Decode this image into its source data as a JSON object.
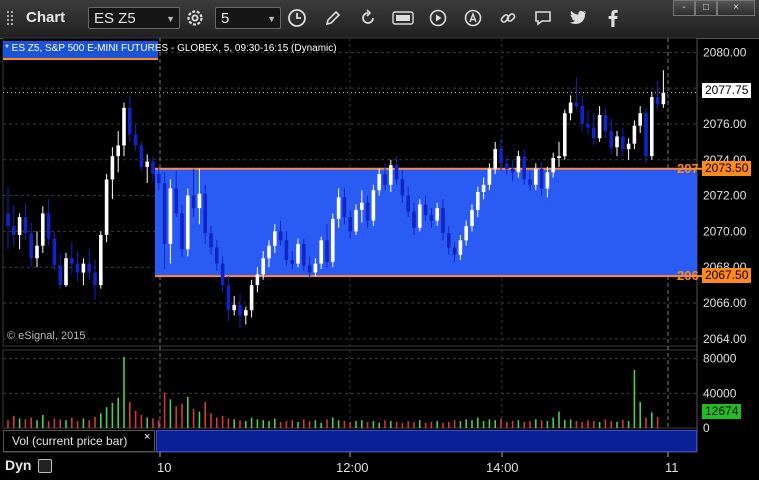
{
  "window": {
    "title": "Chart",
    "symbol": "ES Z5",
    "interval": "5",
    "controls": {
      "minimize": "-",
      "maximize": "□",
      "close": "×"
    }
  },
  "toolbar": {
    "icons": [
      "settings-gear-icon",
      "clock-icon",
      "pencil-draw-icon",
      "refresh-icon",
      "get-quote-icon",
      "play-icon",
      "alert-icon",
      "link-icon",
      "chat-icon",
      "twitter-icon",
      "facebook-icon"
    ]
  },
  "chart": {
    "legend": "* ES Z5, S&P 500 E-MINI FUTURES - GLOBEX, 5, 09:30-16:15 (Dynamic)",
    "copyright": "© eSignal, 2015",
    "last_price": "2077.75",
    "upper_level": {
      "label": "2073.50",
      "cut_label": "207"
    },
    "lower_level": {
      "label": "2067.50",
      "cut_label": "206"
    },
    "price_axis": [
      "2080.00",
      "2078.00",
      "2076.00",
      "2074.00",
      "2072.00",
      "2070.00",
      "2068.00",
      "2066.00",
      "2064.00"
    ],
    "volume_axis": [
      "80000",
      "40000",
      "0"
    ],
    "last_volume": "12674",
    "time_axis": [
      "10",
      "12:00",
      "14:00",
      "11"
    ],
    "volume_study_title": "Vol (current price bar)",
    "volume_study_close": "×",
    "dynamic_label": "Dyn"
  },
  "chart_data": {
    "type": "candlestick",
    "symbol": "ES Z5",
    "ylim": [
      2064,
      2081
    ],
    "volume_ylim": [
      0,
      90000
    ],
    "upper_level": 2073.5,
    "lower_level": 2067.5,
    "last_price": 2077.75,
    "last_volume": 12674,
    "candles": [
      [
        2071.0,
        2072.5,
        2069.0,
        2070.3
      ],
      [
        2070.3,
        2071.5,
        2069.2,
        2069.8
      ],
      [
        2069.8,
        2071.0,
        2069.0,
        2070.8
      ],
      [
        2070.8,
        2071.6,
        2069.5,
        2069.9
      ],
      [
        2069.9,
        2070.5,
        2068.0,
        2068.5
      ],
      [
        2068.5,
        2070.0,
        2068.0,
        2069.2
      ],
      [
        2069.2,
        2071.4,
        2068.8,
        2071.0
      ],
      [
        2071.0,
        2071.8,
        2069.2,
        2069.6
      ],
      [
        2069.6,
        2070.0,
        2067.8,
        2068.1
      ],
      [
        2068.1,
        2068.8,
        2066.8,
        2067.0
      ],
      [
        2067.0,
        2068.8,
        2066.9,
        2068.5
      ],
      [
        2068.5,
        2069.4,
        2067.6,
        2068.2
      ],
      [
        2068.2,
        2068.9,
        2067.2,
        2067.7
      ],
      [
        2067.7,
        2068.5,
        2067.0,
        2068.2
      ],
      [
        2068.2,
        2069.0,
        2067.3,
        2067.7
      ],
      [
        2067.7,
        2068.4,
        2066.2,
        2067.0
      ],
      [
        2067.0,
        2070.0,
        2066.8,
        2069.8
      ],
      [
        2069.8,
        2073.2,
        2069.4,
        2072.9
      ],
      [
        2072.9,
        2074.7,
        2071.8,
        2074.2
      ],
      [
        2074.2,
        2075.6,
        2073.3,
        2074.8
      ],
      [
        2074.8,
        2077.2,
        2074.2,
        2076.9
      ],
      [
        2076.9,
        2077.6,
        2075.0,
        2075.4
      ],
      [
        2075.4,
        2076.0,
        2074.5,
        2074.8
      ],
      [
        2074.8,
        2075.0,
        2073.4,
        2073.6
      ],
      [
        2073.6,
        2074.3,
        2072.7,
        2073.9
      ],
      [
        2073.9,
        2074.2,
        2072.8,
        2073.2
      ],
      [
        2073.2,
        2073.6,
        2072.3,
        2072.7
      ],
      [
        2072.7,
        2073.3,
        2067.9,
        2069.3
      ],
      [
        2069.3,
        2072.9,
        2068.2,
        2072.4
      ],
      [
        2072.4,
        2073.4,
        2070.8,
        2071.0
      ],
      [
        2071.0,
        2071.5,
        2068.6,
        2069.0
      ],
      [
        2069.0,
        2072.4,
        2068.6,
        2072.0
      ],
      [
        2072.0,
        2073.5,
        2070.8,
        2071.3
      ],
      [
        2071.3,
        2073.5,
        2070.4,
        2072.1
      ],
      [
        2072.1,
        2072.6,
        2069.3,
        2069.9
      ],
      [
        2069.9,
        2070.3,
        2068.7,
        2069.1
      ],
      [
        2069.1,
        2069.5,
        2067.8,
        2068.2
      ],
      [
        2068.2,
        2068.6,
        2066.6,
        2067.0
      ],
      [
        2067.0,
        2067.5,
        2065.0,
        2065.6
      ],
      [
        2065.6,
        2066.4,
        2065.3,
        2065.9
      ],
      [
        2065.9,
        2066.5,
        2064.6,
        2065.3
      ],
      [
        2065.3,
        2065.8,
        2064.8,
        2065.6
      ],
      [
        2065.6,
        2067.3,
        2065.2,
        2067.0
      ],
      [
        2067.0,
        2068.0,
        2066.6,
        2067.6
      ],
      [
        2067.6,
        2068.9,
        2067.3,
        2068.5
      ],
      [
        2068.5,
        2069.5,
        2068.0,
        2069.2
      ],
      [
        2069.2,
        2070.4,
        2068.8,
        2070.0
      ],
      [
        2070.0,
        2070.6,
        2069.2,
        2069.5
      ],
      [
        2069.5,
        2070.0,
        2068.1,
        2068.4
      ],
      [
        2068.4,
        2068.9,
        2067.9,
        2068.2
      ],
      [
        2068.2,
        2069.6,
        2068.0,
        2069.3
      ],
      [
        2069.3,
        2069.6,
        2067.8,
        2068.1
      ],
      [
        2068.1,
        2068.6,
        2067.4,
        2067.7
      ],
      [
        2067.7,
        2068.5,
        2067.5,
        2068.2
      ],
      [
        2068.2,
        2069.7,
        2067.9,
        2069.5
      ],
      [
        2069.5,
        2070.4,
        2068.0,
        2068.3
      ],
      [
        2068.3,
        2071.0,
        2068.0,
        2070.7
      ],
      [
        2070.7,
        2072.4,
        2070.2,
        2071.9
      ],
      [
        2071.9,
        2072.4,
        2070.4,
        2070.8
      ],
      [
        2070.8,
        2071.2,
        2069.6,
        2070.0
      ],
      [
        2070.0,
        2071.5,
        2069.8,
        2071.2
      ],
      [
        2071.2,
        2072.3,
        2070.5,
        2071.6
      ],
      [
        2071.6,
        2072.0,
        2070.2,
        2070.6
      ],
      [
        2070.6,
        2072.6,
        2070.3,
        2072.3
      ],
      [
        2072.3,
        2073.5,
        2072.0,
        2073.2
      ],
      [
        2073.2,
        2073.8,
        2072.3,
        2072.6
      ],
      [
        2072.6,
        2074.0,
        2072.2,
        2073.7
      ],
      [
        2073.7,
        2074.2,
        2072.6,
        2072.9
      ],
      [
        2072.9,
        2073.4,
        2071.6,
        2072.0
      ],
      [
        2072.0,
        2072.5,
        2070.8,
        2071.1
      ],
      [
        2071.1,
        2071.6,
        2069.8,
        2070.2
      ],
      [
        2070.2,
        2071.8,
        2070.0,
        2071.5
      ],
      [
        2071.5,
        2072.0,
        2070.6,
        2070.9
      ],
      [
        2070.9,
        2071.3,
        2070.2,
        2070.6
      ],
      [
        2070.6,
        2071.6,
        2070.3,
        2071.3
      ],
      [
        2071.3,
        2071.8,
        2069.5,
        2069.9
      ],
      [
        2069.9,
        2070.3,
        2068.7,
        2069.1
      ],
      [
        2069.1,
        2069.4,
        2068.3,
        2068.7
      ],
      [
        2068.7,
        2069.8,
        2068.4,
        2069.5
      ],
      [
        2069.5,
        2070.6,
        2069.2,
        2070.3
      ],
      [
        2070.3,
        2071.5,
        2070.0,
        2071.2
      ],
      [
        2071.2,
        2072.5,
        2070.8,
        2072.2
      ],
      [
        2072.2,
        2073.0,
        2071.8,
        2072.6
      ],
      [
        2072.6,
        2073.8,
        2072.3,
        2073.5
      ],
      [
        2073.5,
        2075.0,
        2073.2,
        2074.6
      ],
      [
        2074.6,
        2075.2,
        2073.4,
        2073.8
      ],
      [
        2073.8,
        2074.2,
        2073.2,
        2073.5
      ],
      [
        2073.5,
        2074.0,
        2072.8,
        2073.3
      ],
      [
        2073.3,
        2074.5,
        2073.0,
        2074.2
      ],
      [
        2074.2,
        2074.6,
        2072.6,
        2072.9
      ],
      [
        2072.9,
        2073.4,
        2072.3,
        2072.6
      ],
      [
        2072.6,
        2073.8,
        2072.3,
        2073.5
      ],
      [
        2073.5,
        2073.9,
        2072.0,
        2072.4
      ],
      [
        2072.4,
        2073.6,
        2071.9,
        2073.3
      ],
      [
        2073.3,
        2074.4,
        2073.0,
        2074.1
      ],
      [
        2074.1,
        2075.0,
        2073.6,
        2074.2
      ],
      [
        2074.2,
        2076.8,
        2074.0,
        2076.6
      ],
      [
        2076.6,
        2077.6,
        2076.2,
        2077.2
      ],
      [
        2077.2,
        2078.6,
        2076.8,
        2077.0
      ],
      [
        2077.0,
        2077.6,
        2075.6,
        2076.0
      ],
      [
        2076.0,
        2076.8,
        2075.4,
        2075.8
      ],
      [
        2075.8,
        2076.6,
        2074.8,
        2075.2
      ],
      [
        2075.2,
        2077.0,
        2075.0,
        2076.5
      ],
      [
        2076.5,
        2076.9,
        2075.2,
        2075.6
      ],
      [
        2075.6,
        2076.3,
        2074.3,
        2074.7
      ],
      [
        2074.7,
        2075.6,
        2074.2,
        2075.3
      ],
      [
        2075.3,
        2075.8,
        2074.2,
        2074.6
      ],
      [
        2074.6,
        2075.2,
        2074.0,
        2074.9
      ],
      [
        2074.9,
        2076.2,
        2074.6,
        2075.9
      ],
      [
        2075.9,
        2077.0,
        2075.5,
        2076.6
      ],
      [
        2076.6,
        2076.9,
        2073.8,
        2074.2
      ],
      [
        2074.2,
        2077.8,
        2074.0,
        2077.5
      ],
      [
        2077.5,
        2078.4,
        2076.8,
        2077.1
      ],
      [
        2077.1,
        2079.0,
        2076.9,
        2077.75
      ]
    ],
    "volumes": [
      9000,
      14000,
      11000,
      10000,
      12000,
      9000,
      15000,
      8000,
      11000,
      10000,
      9000,
      12000,
      8000,
      11000,
      9000,
      13000,
      17000,
      24000,
      29000,
      35000,
      82000,
      30000,
      20000,
      15000,
      12000,
      11000,
      9000,
      41000,
      33000,
      25000,
      28000,
      36000,
      22000,
      19000,
      30000,
      17000,
      12000,
      14000,
      11000,
      10000,
      9000,
      8000,
      12000,
      10000,
      9000,
      8000,
      11000,
      7000,
      8000,
      9000,
      7000,
      10000,
      8000,
      9000,
      6000,
      10000,
      12000,
      9000,
      8000,
      7000,
      8000,
      9000,
      7000,
      8000,
      6000,
      9000,
      8000,
      7000,
      6000,
      8000,
      7000,
      9000,
      6000,
      7000,
      8000,
      6000,
      7000,
      9000,
      8000,
      10000,
      9000,
      12000,
      8000,
      10000,
      9000,
      11000,
      7000,
      8000,
      9000,
      7000,
      8000,
      10000,
      9000,
      8000,
      12000,
      19000,
      9000,
      10000,
      8000,
      7000,
      9000,
      8000,
      7000,
      10000,
      8000,
      7000,
      9000,
      8000,
      67000,
      30000,
      12000,
      18000,
      12674
    ]
  },
  "colors": {
    "up_candle": "#ffffff",
    "down_candle": "#1024c8",
    "level_line": "#ff8a3d",
    "zone_fill": "#2a5cf5",
    "volume_up": "#4ecf4e",
    "volume_down": "#d43a3a",
    "last_price_tag": "#ffffff",
    "last_volume_tag": "#1fbf1f",
    "level_tag": "#ff8a1a"
  }
}
